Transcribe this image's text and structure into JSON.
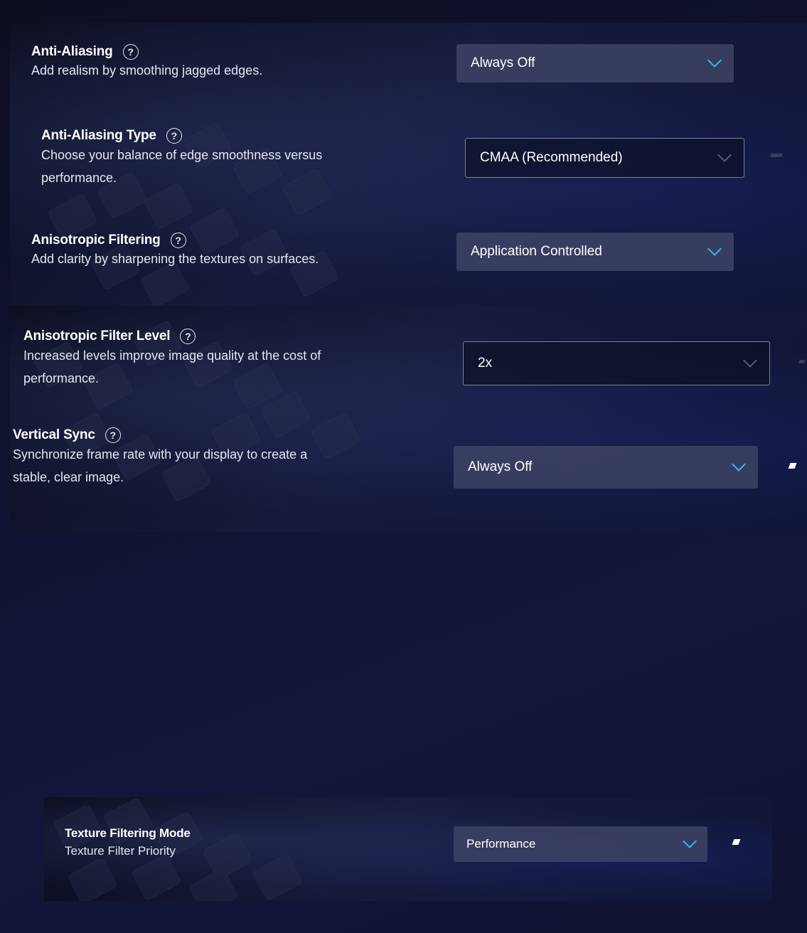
{
  "settings": [
    {
      "title": "Anti-Aliasing",
      "description": "Add realism by smoothing jagged edges.",
      "value": "Always Off"
    },
    {
      "title": "Anti-Aliasing Type",
      "description_line1": "Choose your balance of edge smoothness versus",
      "description_line2": "performance.",
      "value": "CMAA (Recommended)"
    },
    {
      "title": "Anisotropic Filtering",
      "description": "Add clarity by sharpening the textures on surfaces.",
      "value": "Application Controlled"
    },
    {
      "title": "Anisotropic Filter Level",
      "description_line1": "Increased levels improve image quality at the cost of",
      "description_line2": "performance.",
      "value": "2x"
    },
    {
      "title": "Vertical Sync",
      "description_line1": "Synchronize frame rate with your display to create a",
      "description_line2": "stable, clear image.",
      "value": "Always Off"
    }
  ],
  "texture": {
    "title": "Texture Filtering Mode",
    "description": "Texture Filter Priority",
    "value": "Performance"
  },
  "help_glyph": "?",
  "icons": {
    "help": "question-circle-icon",
    "dropdown": "chevron-down-icon"
  },
  "colors": {
    "accent": "#38b8e6",
    "background": "#101330",
    "dropdown_fill": "#3c4264"
  }
}
